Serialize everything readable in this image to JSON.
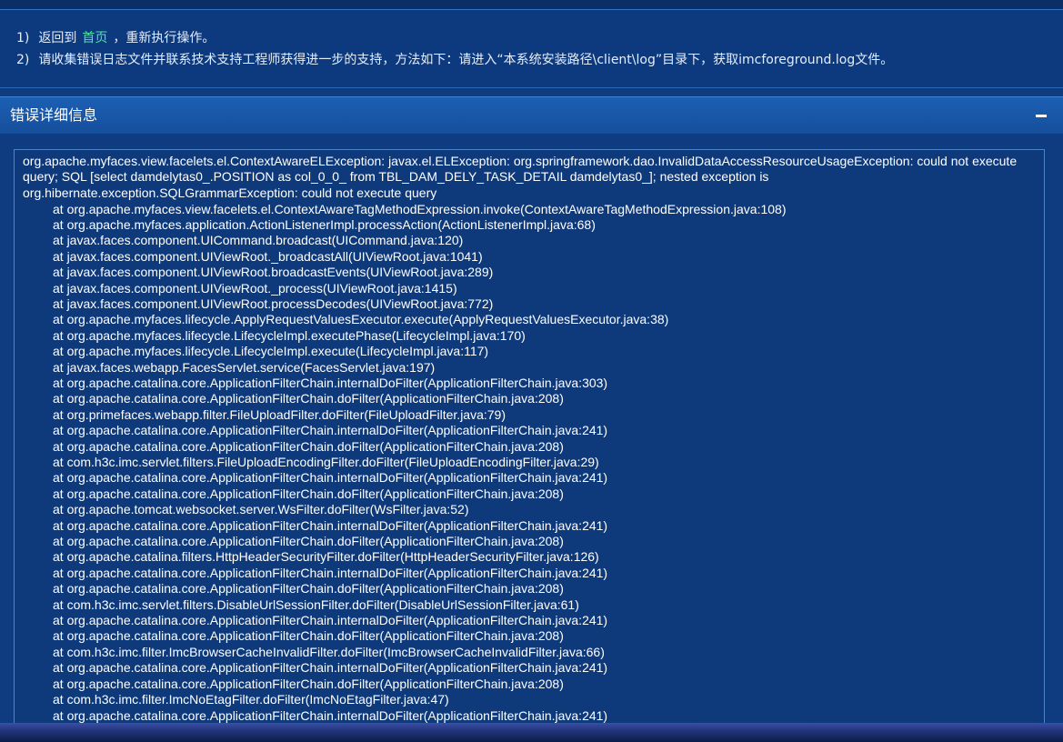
{
  "tips": {
    "line1": {
      "num": "1)",
      "before": "返回到",
      "link": "首页",
      "after": "，重新执行操作。"
    },
    "line2": {
      "num": "2)",
      "text": "请收集错误日志文件并联系技术支持工程师获得进一步的支持，方法如下：请进入“本系统安装路径\\client\\log”目录下，获取imcforeground.log文件。"
    }
  },
  "panel": {
    "title": "错误详细信息",
    "collapse_icon": "minus-icon"
  },
  "trace": {
    "message": "org.apache.myfaces.view.facelets.el.ContextAwareELException: javax.el.ELException: org.springframework.dao.InvalidDataAccessResourceUsageException: could not execute query; SQL [select damdelytas0_.POSITION as col_0_0_ from TBL_DAM_DELY_TASK_DETAIL damdelytas0_]; nested exception is org.hibernate.exception.SQLGrammarException: could not execute query",
    "frames": [
      "at org.apache.myfaces.view.facelets.el.ContextAwareTagMethodExpression.invoke(ContextAwareTagMethodExpression.java:108)",
      "at org.apache.myfaces.application.ActionListenerImpl.processAction(ActionListenerImpl.java:68)",
      "at javax.faces.component.UICommand.broadcast(UICommand.java:120)",
      "at javax.faces.component.UIViewRoot._broadcastAll(UIViewRoot.java:1041)",
      "at javax.faces.component.UIViewRoot.broadcastEvents(UIViewRoot.java:289)",
      "at javax.faces.component.UIViewRoot._process(UIViewRoot.java:1415)",
      "at javax.faces.component.UIViewRoot.processDecodes(UIViewRoot.java:772)",
      "at org.apache.myfaces.lifecycle.ApplyRequestValuesExecutor.execute(ApplyRequestValuesExecutor.java:38)",
      "at org.apache.myfaces.lifecycle.LifecycleImpl.executePhase(LifecycleImpl.java:170)",
      "at org.apache.myfaces.lifecycle.LifecycleImpl.execute(LifecycleImpl.java:117)",
      "at javax.faces.webapp.FacesServlet.service(FacesServlet.java:197)",
      "at org.apache.catalina.core.ApplicationFilterChain.internalDoFilter(ApplicationFilterChain.java:303)",
      "at org.apache.catalina.core.ApplicationFilterChain.doFilter(ApplicationFilterChain.java:208)",
      "at org.primefaces.webapp.filter.FileUploadFilter.doFilter(FileUploadFilter.java:79)",
      "at org.apache.catalina.core.ApplicationFilterChain.internalDoFilter(ApplicationFilterChain.java:241)",
      "at org.apache.catalina.core.ApplicationFilterChain.doFilter(ApplicationFilterChain.java:208)",
      "at com.h3c.imc.servlet.filters.FileUploadEncodingFilter.doFilter(FileUploadEncodingFilter.java:29)",
      "at org.apache.catalina.core.ApplicationFilterChain.internalDoFilter(ApplicationFilterChain.java:241)",
      "at org.apache.catalina.core.ApplicationFilterChain.doFilter(ApplicationFilterChain.java:208)",
      "at org.apache.tomcat.websocket.server.WsFilter.doFilter(WsFilter.java:52)",
      "at org.apache.catalina.core.ApplicationFilterChain.internalDoFilter(ApplicationFilterChain.java:241)",
      "at org.apache.catalina.core.ApplicationFilterChain.doFilter(ApplicationFilterChain.java:208)",
      "at org.apache.catalina.filters.HttpHeaderSecurityFilter.doFilter(HttpHeaderSecurityFilter.java:126)",
      "at org.apache.catalina.core.ApplicationFilterChain.internalDoFilter(ApplicationFilterChain.java:241)",
      "at org.apache.catalina.core.ApplicationFilterChain.doFilter(ApplicationFilterChain.java:208)",
      "at com.h3c.imc.servlet.filters.DisableUrlSessionFilter.doFilter(DisableUrlSessionFilter.java:61)",
      "at org.apache.catalina.core.ApplicationFilterChain.internalDoFilter(ApplicationFilterChain.java:241)",
      "at org.apache.catalina.core.ApplicationFilterChain.doFilter(ApplicationFilterChain.java:208)",
      "at com.h3c.imc.filter.ImcBrowserCacheInvalidFilter.doFilter(ImcBrowserCacheInvalidFilter.java:66)",
      "at org.apache.catalina.core.ApplicationFilterChain.internalDoFilter(ApplicationFilterChain.java:241)",
      "at org.apache.catalina.core.ApplicationFilterChain.doFilter(ApplicationFilterChain.java:208)",
      "at com.h3c.imc.filter.ImcNoEtagFilter.doFilter(ImcNoEtagFilter.java:47)",
      "at org.apache.catalina.core.ApplicationFilterChain.internalDoFilter(ApplicationFilterChain.java:241)"
    ]
  }
}
